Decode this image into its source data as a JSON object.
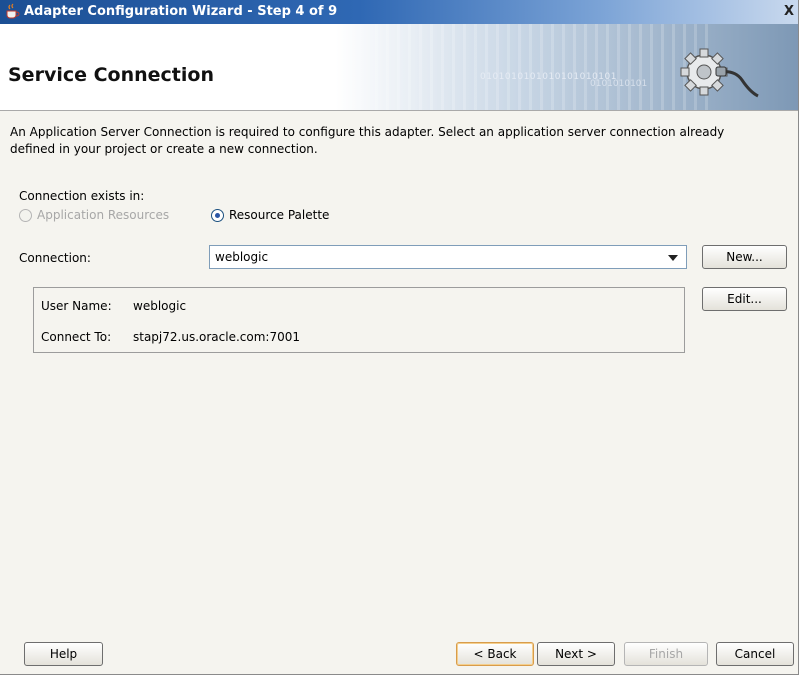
{
  "window": {
    "title": "Adapter Configuration Wizard - Step 4 of 9",
    "close_glyph": "X"
  },
  "banner": {
    "heading": "Service Connection",
    "binary_text_1": "0101010101010101010101",
    "binary_text_2": "0101010101"
  },
  "intro_line1": "An Application Server Connection is required to configure this adapter. Select an application server connection already",
  "intro_line2": "defined in your project or create a new connection.",
  "connection_exists": {
    "label": "Connection exists in:",
    "options": [
      {
        "label": "Application Resources",
        "selected": false,
        "disabled": true
      },
      {
        "label": "Resource Palette",
        "selected": true,
        "disabled": false
      }
    ]
  },
  "connection": {
    "label": "Connection:",
    "value": "weblogic"
  },
  "details": {
    "user_name_label": "User Name:",
    "user_name": "weblogic",
    "connect_to_label": "Connect To:",
    "connect_to": "stapj72.us.oracle.com:7001"
  },
  "buttons": {
    "new": "New...",
    "edit": "Edit...",
    "help": "Help",
    "back": "< Back",
    "next": "Next >",
    "finish": "Finish",
    "cancel": "Cancel"
  },
  "icons": {
    "title": "java-cup-icon",
    "banner": "gear-plug-icon"
  }
}
